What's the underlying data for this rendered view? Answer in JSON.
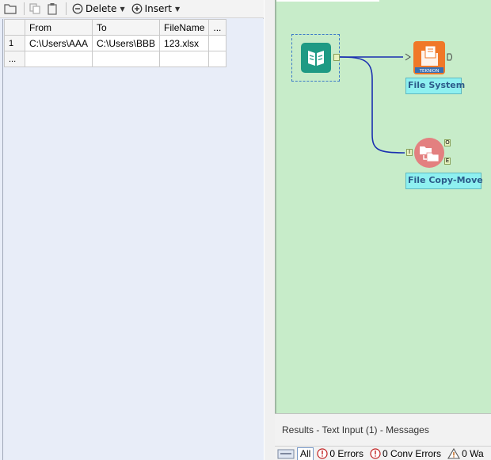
{
  "toolbar": {
    "delete_label": "Delete",
    "insert_label": "Insert"
  },
  "grid": {
    "headers": [
      "From",
      "To",
      "FileName",
      "..."
    ],
    "rows": [
      {
        "num": "1",
        "cells": [
          "C:\\Users\\AAA",
          "C:\\Users\\BBB",
          "123.xlsx",
          ""
        ]
      }
    ],
    "new_row_marker": "..."
  },
  "canvas": {
    "tools": {
      "file_system": {
        "label": "File System",
        "badge": "TEKNION"
      },
      "file_copy": {
        "label": "File Copy-Move"
      }
    },
    "anchors": {
      "input": "I",
      "output": "O",
      "error": "E"
    }
  },
  "results": {
    "title": "Results - Text Input (1) - Messages",
    "all_label": "All",
    "errors": "0 Errors",
    "conv_errors": "0 Conv Errors",
    "warnings": "0 Wa"
  },
  "colors": {
    "canvas_bg": "#c7ecc9",
    "connector": "#1a2fb0",
    "label_bg": "#8ef0f0",
    "input_tool": "#1e9a84",
    "fs_tool": "#f07828",
    "copy_tool": "#e38080"
  }
}
